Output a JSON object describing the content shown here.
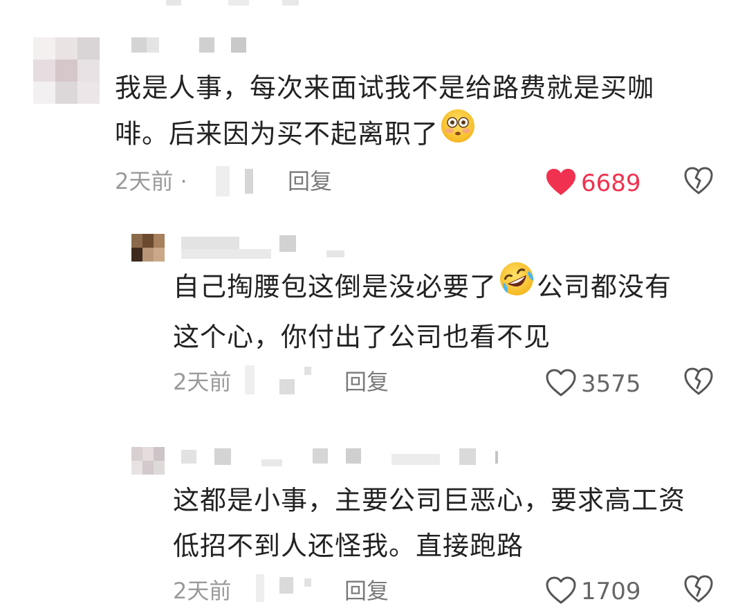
{
  "comments": [
    {
      "text": "我是人事，每次来面试我不是给路费就是买咖\n啡。后来因为买不起离职了",
      "emoji": "flushed-face",
      "time": "2天前",
      "separator": "·",
      "reply_label": "回复",
      "likes": "6689",
      "liked": true
    },
    {
      "text_before": "自己掏腰包这倒是没必要了",
      "emoji": "rolling-on-floor-laughing-face",
      "text_after": "公司都没有\n这个心，你付出了公司也看不见",
      "time": "2天前",
      "reply_label": "回复",
      "likes": "3575",
      "liked": false
    },
    {
      "text": "这都是小事，主要公司巨恶心，要求高工资\n低招不到人还怪我。直接跑路",
      "time": "2天前",
      "reply_label": "回复",
      "likes": "1709",
      "liked": false
    }
  ],
  "colors": {
    "like_active": "#f0314f",
    "like_inactive": "#555555",
    "meta_gray": "#9a9a9a"
  }
}
